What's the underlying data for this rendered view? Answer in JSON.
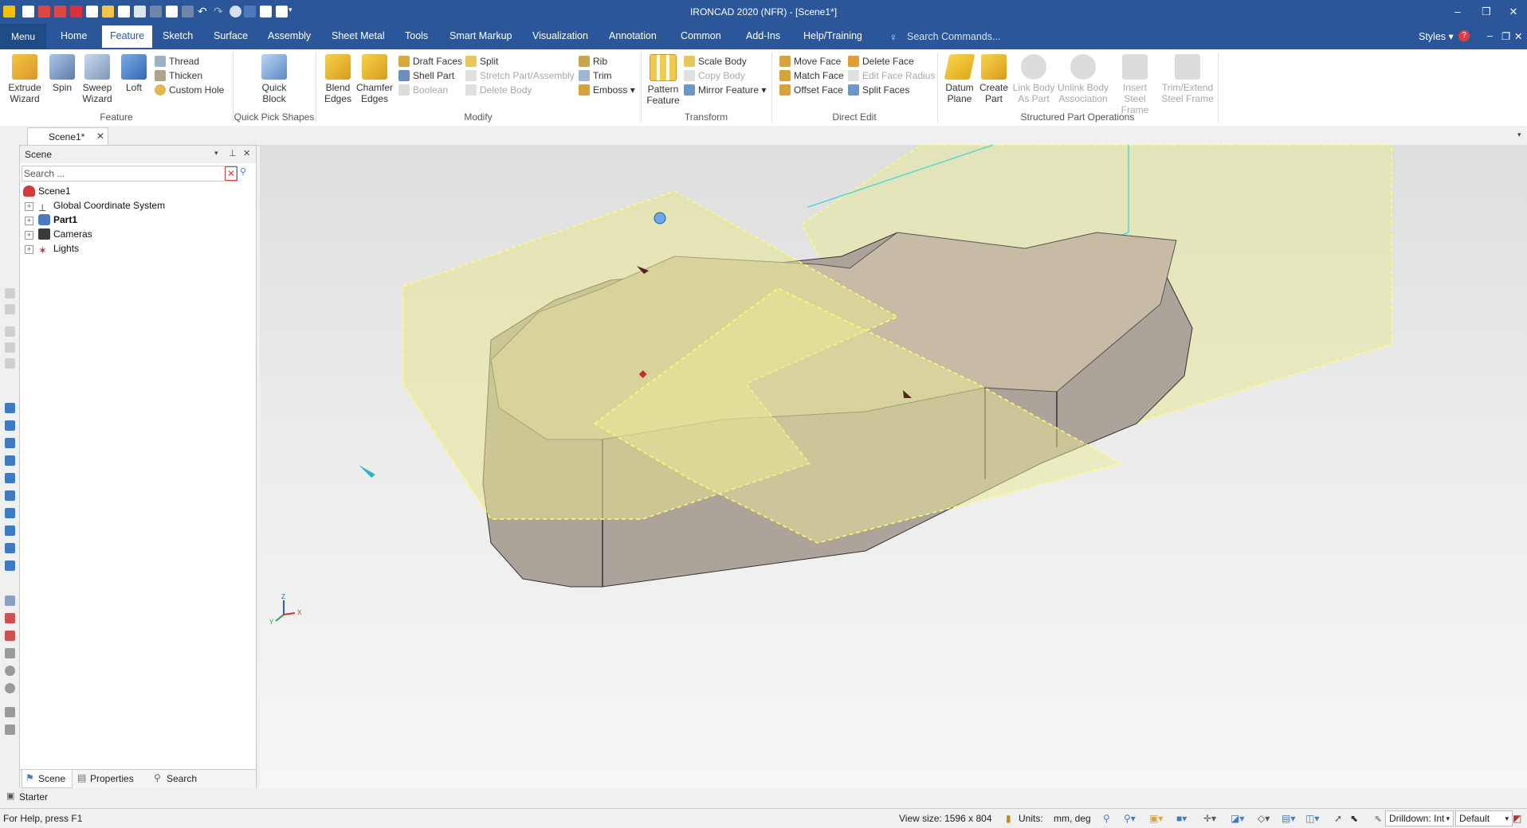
{
  "app": {
    "title": "IRONCAD 2020 (NFR) - [Scene1*]"
  },
  "menu": {
    "menu_label": "Menu",
    "tabs": [
      "Home",
      "Feature",
      "Sketch",
      "Surface",
      "Assembly",
      "Sheet Metal",
      "Tools",
      "Smart Markup",
      "Visualization",
      "Annotation",
      "Common",
      "Add-Ins",
      "Help/Training"
    ],
    "active_tab": "Feature",
    "search_placeholder": "Search Commands...",
    "styles_label": "Styles"
  },
  "ribbon": {
    "feature": {
      "extrude": "Extrude\nWizard",
      "spin": "Spin",
      "sweep": "Sweep\nWizard",
      "loft": "Loft",
      "thread": "Thread",
      "thicken": "Thicken",
      "custom_hole": "Custom Hole",
      "group": "Feature"
    },
    "quick": {
      "label": "Quick\nBlock",
      "group": "Quick Pick Shapes"
    },
    "modify": {
      "blend": "Blend\nEdges",
      "chamfer": "Chamfer\nEdges",
      "draft": "Draft Faces",
      "shell": "Shell Part",
      "boolean": "Boolean",
      "split": "Split",
      "stretch": "Stretch Part/Assembly",
      "delete_body": "Delete Body",
      "rib": "Rib",
      "trim": "Trim",
      "emboss": "Emboss",
      "group": "Modify"
    },
    "transform": {
      "pattern": "Pattern\nFeature",
      "scale": "Scale Body",
      "copy": "Copy Body",
      "mirror": "Mirror Feature",
      "group": "Transform"
    },
    "direct": {
      "move": "Move Face",
      "match": "Match Face",
      "offset": "Offset Face",
      "delete_face": "Delete Face",
      "edit_radius": "Edit Face Radius",
      "split_faces": "Split Faces",
      "group": "Direct Edit"
    },
    "structured": {
      "datum": "Datum\nPlane",
      "create_part": "Create\nPart",
      "link_body": "Link Body\nAs Part",
      "unlink_body": "Unlink Body\nAssociation",
      "insert_steel": "Insert Steel\nFrame",
      "trim_steel": "Trim/Extend\nSteel Frame",
      "group": "Structured Part Operations"
    }
  },
  "doc_tab": {
    "label": "Scene1*"
  },
  "scene_panel": {
    "title": "Scene",
    "search_placeholder": "Search ...",
    "tree": {
      "root": "Scene1",
      "items": [
        "Global Coordinate System",
        "Part1",
        "Cameras",
        "Lights"
      ]
    },
    "tabs": [
      "Scene",
      "Properties",
      "Search"
    ]
  },
  "starter": "Starter",
  "status": {
    "help": "For Help, press F1",
    "view_size": "View size: 1596 x  804",
    "units_label": "Units:",
    "units_value": "mm, deg",
    "drilldown": "Drilldown: Int",
    "default": "Default"
  },
  "triad": {
    "z": "Z",
    "x": "X",
    "y": "Y"
  },
  "colors": {
    "accent": "#2b579a",
    "bounding_box": "#e8e89a",
    "part_face": "#8a8276",
    "selection_edge": "#ffff66"
  }
}
